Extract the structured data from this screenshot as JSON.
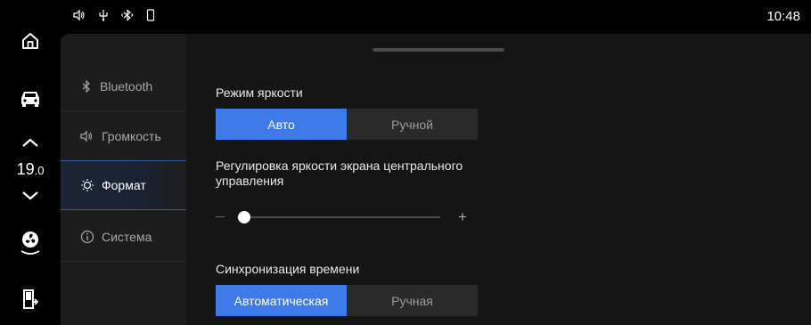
{
  "status_bar": {
    "icons": [
      "volume-icon",
      "usb-icon",
      "bluetooth-icon",
      "phone-icon"
    ],
    "time": "10:48"
  },
  "rail": {
    "items": [
      "home-icon",
      "car-icon",
      "chevron-up-icon",
      "chevron-down-icon",
      "fan-icon",
      "seat-icon"
    ],
    "temperature": "19",
    "temperature_decimal": ".0"
  },
  "nav": {
    "items": [
      {
        "label": "Bluetooth",
        "icon": "bluetooth-icon"
      },
      {
        "label": "Громкость",
        "icon": "volume-icon"
      },
      {
        "label": "Формат",
        "icon": "sun-icon"
      },
      {
        "label": "Система",
        "icon": "info-icon"
      }
    ],
    "active": "Формат"
  },
  "settings": {
    "brightness_mode": {
      "title": "Режим яркости",
      "options": [
        "Авто",
        "Ручной"
      ],
      "selected": "Авто"
    },
    "brightness_adjust": {
      "title": "Регулировка яркости экрана центрального управления",
      "level": 0.03
    },
    "time_sync": {
      "title": "Синхронизация времени",
      "options": [
        "Автоматическая",
        "Ручная"
      ],
      "selected": "Автоматическая"
    }
  },
  "colors": {
    "accent": "#3f7be8",
    "panel_bg": "#151515",
    "nav_bg": "#1d1d1d"
  }
}
